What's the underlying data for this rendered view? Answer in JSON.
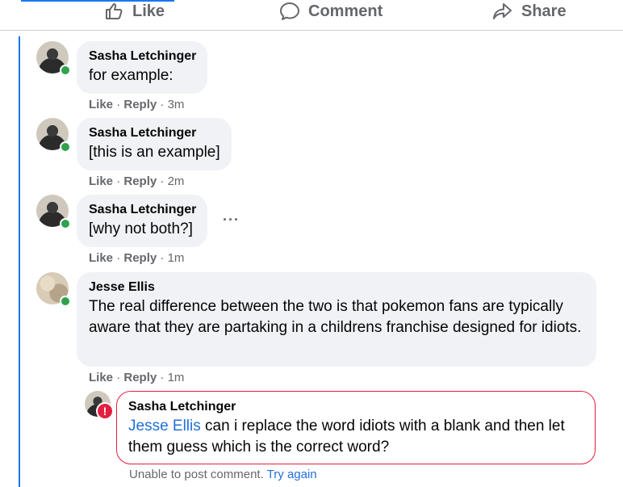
{
  "actions": {
    "like_label": "Like",
    "comment_label": "Comment",
    "share_label": "Share"
  },
  "comments": [
    {
      "author": "Sasha Letchinger",
      "text": "for example:",
      "like": "Like",
      "reply": "Reply",
      "time": "3m"
    },
    {
      "author": "Sasha Letchinger",
      "text": "[this is an example]",
      "like": "Like",
      "reply": "Reply",
      "time": "2m"
    },
    {
      "author": "Sasha Letchinger",
      "text": "[why not both?]",
      "like": "Like",
      "reply": "Reply",
      "time": "1m"
    },
    {
      "author": "Jesse Ellis",
      "text": "The real difference between the two is that pokemon fans are typically aware that they are partaking in a childrens franchise designed for idiots.",
      "like": "Like",
      "reply": "Reply",
      "time": "1m"
    }
  ],
  "failed_reply": {
    "author": "Sasha Letchinger",
    "mention": "Jesse Ellis",
    "text": " can i replace the word idiots with a blank and then let them guess which is the correct word?",
    "error_text": "Unable to post comment.",
    "retry_label": "Try again",
    "error_glyph": "!"
  },
  "more_options_glyph": "···",
  "separator": "·",
  "colors": {
    "accent": "#1877f2",
    "online": "#31a24c",
    "error": "#e41e3f",
    "bubble": "#f0f2f5",
    "meta": "#65676b"
  },
  "icons": [
    "like-thumb-icon",
    "comment-bubble-icon",
    "share-arrow-icon",
    "more-options-icon",
    "error-icon"
  ]
}
